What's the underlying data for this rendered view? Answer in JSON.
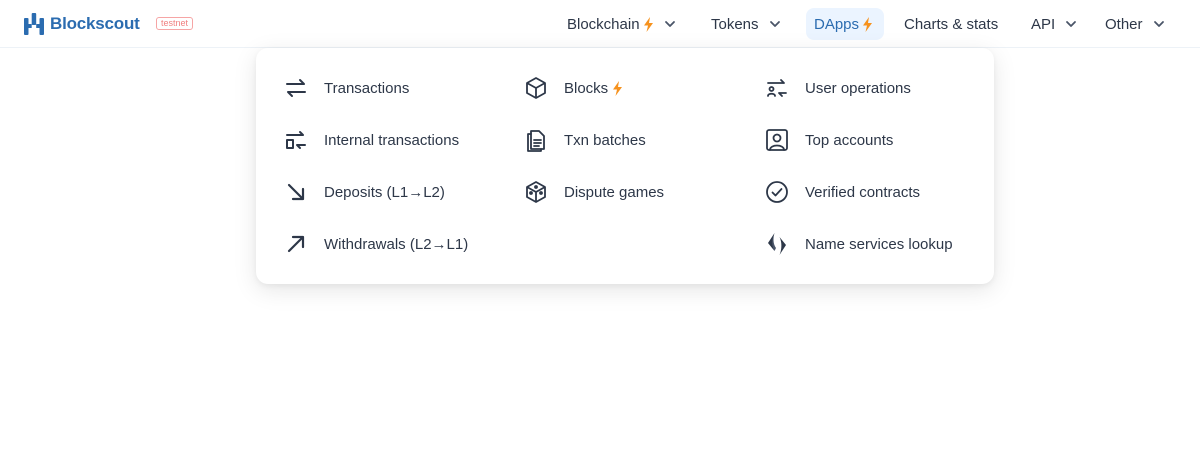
{
  "header": {
    "logo_text": "Blockscout",
    "network_badge": "testnet",
    "nav": [
      {
        "label": "Blockchain",
        "new": true,
        "dropdown": true
      },
      {
        "label": "Tokens",
        "new": false,
        "dropdown": true
      },
      {
        "label": "DApps",
        "new": true,
        "dropdown": false,
        "active": true
      },
      {
        "label": "Charts & stats",
        "new": false,
        "dropdown": false
      },
      {
        "label": "API",
        "new": false,
        "dropdown": true
      },
      {
        "label": "Other",
        "new": false,
        "dropdown": true
      }
    ]
  },
  "menu": {
    "columns": [
      [
        {
          "label": "Transactions",
          "icon": "transactions-icon"
        },
        {
          "label": "Internal transactions",
          "icon": "internal-transactions-icon"
        },
        {
          "label": "Deposits (L1→L2)",
          "icon": "arrow-down-right-icon"
        },
        {
          "label": "Withdrawals (L2→L1)",
          "icon": "arrow-up-right-icon"
        }
      ],
      [
        {
          "label": "Blocks",
          "icon": "block-icon",
          "new": true
        },
        {
          "label": "Txn batches",
          "icon": "document-icon"
        },
        {
          "label": "Dispute games",
          "icon": "cube-games-icon"
        }
      ],
      [
        {
          "label": "User operations",
          "icon": "user-operations-icon"
        },
        {
          "label": "Top accounts",
          "icon": "top-accounts-icon"
        },
        {
          "label": "Verified contracts",
          "icon": "check-circle-icon"
        },
        {
          "label": "Name services lookup",
          "icon": "name-services-icon"
        }
      ]
    ]
  },
  "colors": {
    "brand": "#2b6cb0",
    "accent": "#f6921e",
    "active_bg": "#ebf4ff",
    "text": "#2d3748",
    "badge": "#f08080"
  }
}
